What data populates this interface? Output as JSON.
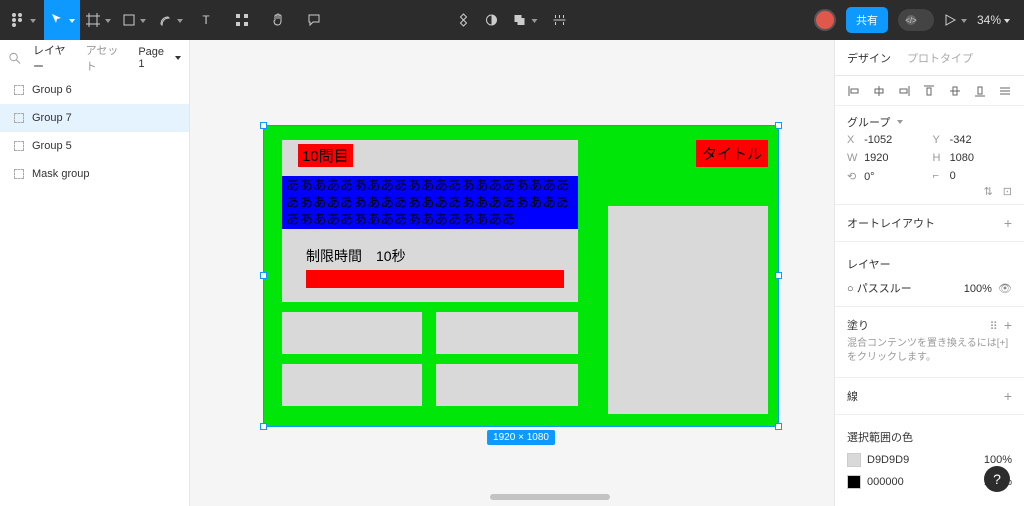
{
  "toolbar": {
    "share_label": "共有",
    "zoom_label": "34%"
  },
  "left_panel": {
    "tab_layers": "レイヤー",
    "tab_assets": "アセット",
    "page_label": "Page 1",
    "layers": [
      {
        "label": "Group 6"
      },
      {
        "label": "Group 7"
      },
      {
        "label": "Group 5"
      },
      {
        "label": "Mask group"
      }
    ]
  },
  "canvas": {
    "dimensions_label": "1920 × 1080",
    "question_badge": "10問目",
    "question_text": "あああああああああああああああああああああああああああああああああああああああああああああああああああああああああああ",
    "timer_label": "制限時間　10秒",
    "title_badge": "タイトル"
  },
  "right_panel": {
    "tab_design": "デザイン",
    "tab_prototype": "プロトタイプ",
    "group_section": "グループ",
    "x_label": "X",
    "x_val": "-1052",
    "y_label": "Y",
    "y_val": "-342",
    "w_label": "W",
    "w_val": "1920",
    "h_label": "H",
    "h_val": "1080",
    "rot_val": "0°",
    "radius_val": "0",
    "autolayout_label": "オートレイアウト",
    "layer_section": "レイヤー",
    "blend_mode": "パススルー",
    "layer_opacity": "100%",
    "fill_section": "塗り",
    "fill_note": "混合コンテンツを置き換えるには[+]をクリックします。",
    "stroke_section": "線",
    "sel_colors_section": "選択範囲の色",
    "color1_hex": "D9D9D9",
    "color1_pct": "100%",
    "color2_hex": "000000",
    "color2_pct": "100%"
  }
}
